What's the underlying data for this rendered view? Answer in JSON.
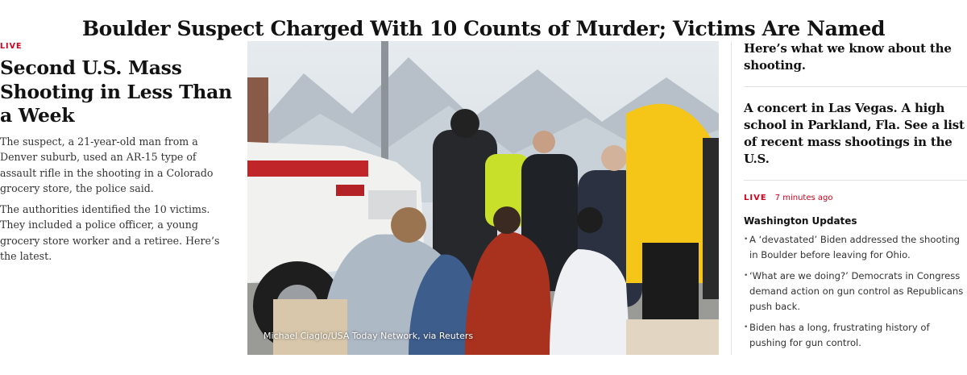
{
  "main_headline": "Boulder Suspect Charged With 10 Counts of Murder; Victims Are Named",
  "left_story": {
    "live_label": "LIVE",
    "title": "Second U.S. Mass Shooting in Less Than a Week",
    "summary_1": "The suspect, a 21-year-old man from a Denver suburb, used an AR-15 type of assault rifle in the shooting in a Colorado grocery store, the police said.",
    "summary_2": "The authorities identified the 10 victims. They included a police officer, a young grocery store worker and a retiree. Here’s the latest."
  },
  "photo": {
    "credit": "Michael Ciaglo/USA Today Network, via Reuters"
  },
  "right_column": {
    "story_1": "Here’s what we know about the shooting.",
    "story_2": "A concert in Las Vegas. A high school in Parkland, Fla. See a list of recent mass shootings in the U.S.",
    "live_label": "LIVE",
    "live_time": "7 minutes ago",
    "updates_title": "Washington Updates",
    "updates": [
      "A ‘devastated’ Biden addressed the shooting in Boulder before leaving for Ohio.",
      "‘What are we doing?’ Democrats in Congress demand action on gun control as Republicans push back.",
      "Biden has a long, frustrating history of pushing for gun control."
    ]
  },
  "colors": {
    "live_red": "#d0021b",
    "text_dark": "#121212",
    "text_body": "#333333",
    "rule_gray": "#e2e2e2"
  }
}
